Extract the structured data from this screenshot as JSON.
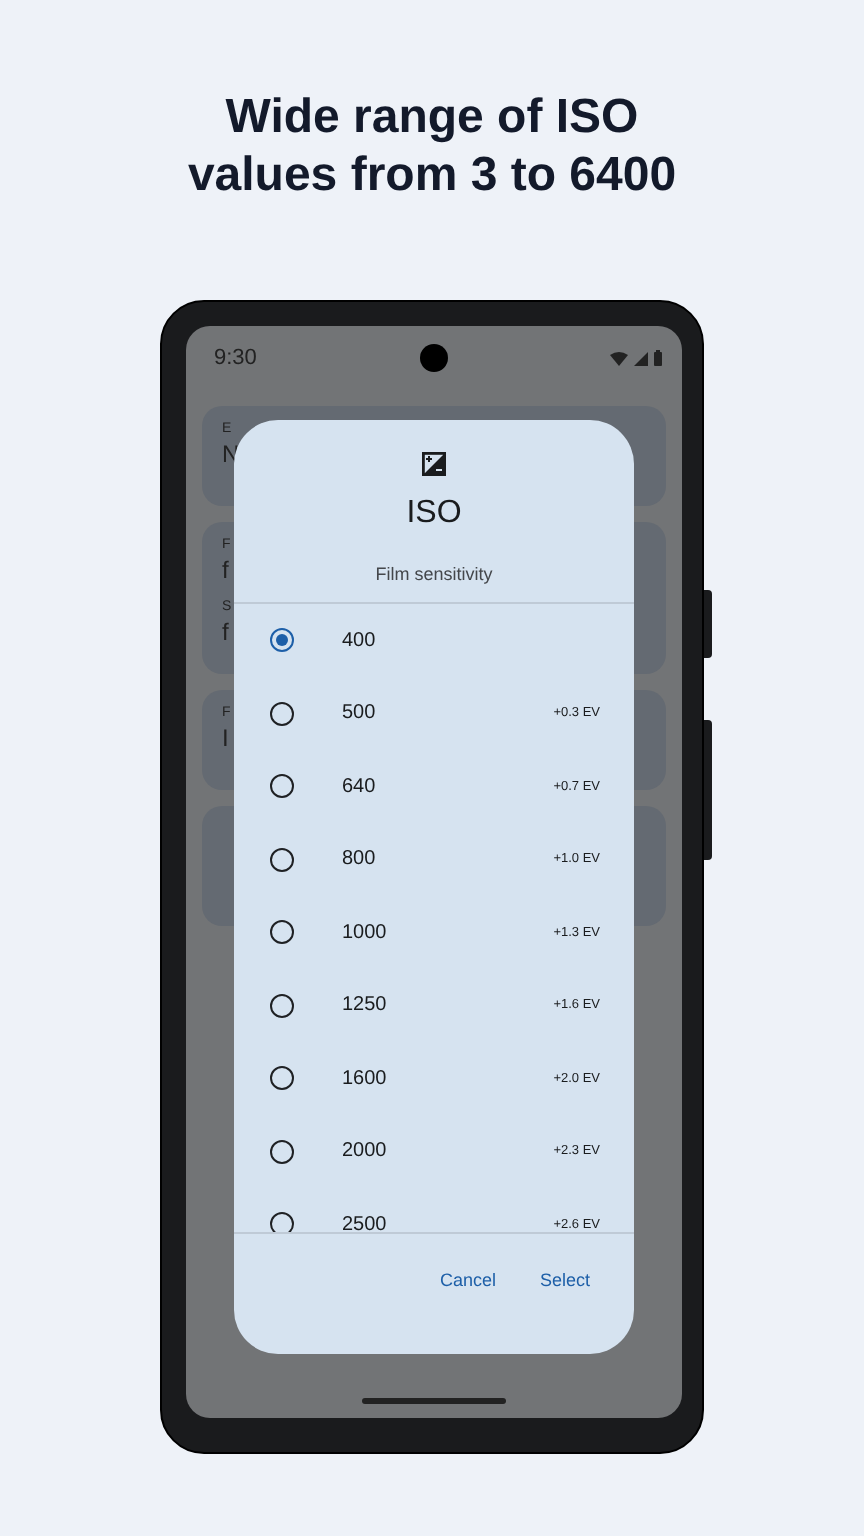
{
  "headline": "Wide range of ISO values from 3 to 6400",
  "status_bar": {
    "time": "9:30"
  },
  "background_cards": [
    {
      "lines": [
        {
          "kind": "label",
          "text": "E"
        },
        {
          "kind": "value",
          "text": "N"
        }
      ]
    },
    {
      "lines": [
        {
          "kind": "label",
          "text": "F"
        },
        {
          "kind": "value",
          "text": "f"
        },
        {
          "kind": "label",
          "text": "S"
        },
        {
          "kind": "value",
          "text": "f"
        }
      ]
    },
    {
      "lines": [
        {
          "kind": "label",
          "text": "F"
        },
        {
          "kind": "value",
          "text": "I"
        }
      ]
    }
  ],
  "dialog": {
    "title": "ISO",
    "subtitle": "Film sensitivity",
    "options": [
      {
        "value": "400",
        "selected": true
      },
      {
        "value": "500",
        "ev": "+0.3 EV",
        "selected": false
      },
      {
        "value": "640",
        "ev": "+0.7 EV",
        "selected": false
      },
      {
        "value": "800",
        "ev": "+1.0 EV",
        "selected": false
      },
      {
        "value": "1000",
        "ev": "+1.3 EV",
        "selected": false
      },
      {
        "value": "1250",
        "ev": "+1.6 EV",
        "selected": false
      },
      {
        "value": "1600",
        "ev": "+2.0 EV",
        "selected": false
      },
      {
        "value": "2000",
        "ev": "+2.3 EV",
        "selected": false
      },
      {
        "value": "2500",
        "ev": "+2.6 EV",
        "selected": false
      }
    ],
    "buttons": [
      "Cancel",
      "Select"
    ]
  }
}
